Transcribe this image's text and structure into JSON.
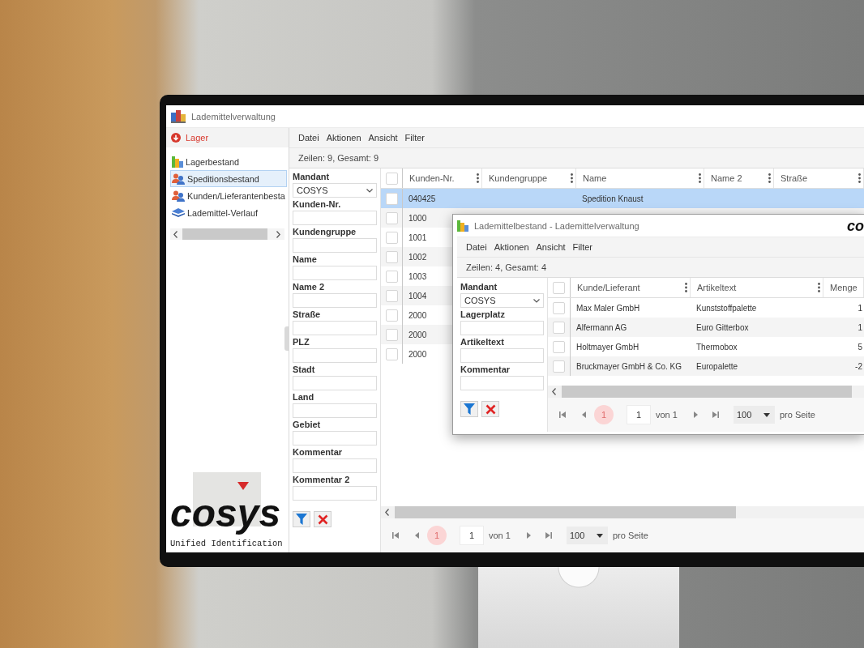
{
  "main_window": {
    "title": "Lademittelverwaltung",
    "sidebar": {
      "group": {
        "label": "Lager",
        "expanded": true
      },
      "items": [
        {
          "kind": "chart",
          "label": "Lagerbestand",
          "selected": false
        },
        {
          "kind": "people",
          "label": "Speditionsbestand",
          "selected": true
        },
        {
          "kind": "people",
          "label": "Kunden/Lieferantenbesta",
          "selected": false
        },
        {
          "kind": "layers",
          "label": "Lademittel-Verlauf",
          "selected": false
        }
      ]
    },
    "logo": {
      "wordmark": "cosys",
      "tagline": "Unified Identification"
    },
    "menu": [
      "Datei",
      "Aktionen",
      "Ansicht",
      "Filter"
    ],
    "status": "Zeilen: 9, Gesamt: 9",
    "filters": [
      {
        "kind": "select",
        "label": "Mandant",
        "value": "COSYS"
      },
      {
        "kind": "text",
        "label": "Kunden-Nr."
      },
      {
        "kind": "text",
        "label": "Kundengruppe"
      },
      {
        "kind": "text",
        "label": "Name"
      },
      {
        "kind": "text",
        "label": "Name 2"
      },
      {
        "kind": "text",
        "label": "Straße"
      },
      {
        "kind": "text",
        "label": "PLZ"
      },
      {
        "kind": "text",
        "label": "Stadt"
      },
      {
        "kind": "text",
        "label": "Land"
      },
      {
        "kind": "text",
        "label": "Gebiet"
      },
      {
        "kind": "text",
        "label": "Kommentar"
      },
      {
        "kind": "text",
        "label": "Kommentar 2"
      }
    ],
    "table": {
      "all_checked": false,
      "columns": [
        {
          "label": "Kunden-Nr.",
          "menu": true
        },
        {
          "label": "Kundengruppe",
          "menu": true
        },
        {
          "label": "Name",
          "menu": true
        },
        {
          "label": "Name 2",
          "menu": true
        },
        {
          "label": "Straße",
          "menu": true
        }
      ],
      "rows": [
        {
          "selected": true,
          "checked": false,
          "cells": [
            "040425",
            null,
            "Spedition Knaust"
          ]
        },
        {
          "selected": false,
          "checked": false,
          "cells": [
            "1000"
          ]
        },
        {
          "selected": false,
          "checked": false,
          "cells": [
            "1001"
          ]
        },
        {
          "selected": false,
          "checked": false,
          "cells": [
            "1002"
          ]
        },
        {
          "selected": false,
          "checked": false,
          "cells": [
            "1003"
          ]
        },
        {
          "selected": false,
          "checked": false,
          "cells": [
            "1004"
          ]
        },
        {
          "selected": false,
          "checked": false,
          "cells": [
            "2000"
          ]
        },
        {
          "selected": false,
          "checked": false,
          "cells": [
            "2000"
          ]
        },
        {
          "selected": false,
          "checked": false,
          "cells": [
            "2000"
          ]
        }
      ]
    },
    "pager": {
      "current": "1",
      "page": "1",
      "of": "von 1",
      "size": "100",
      "per_page": "pro Seite"
    }
  },
  "dialog_window": {
    "title": "Lademittelbestand - Lademittelverwaltung",
    "logo": "co",
    "menu": [
      "Datei",
      "Aktionen",
      "Ansicht",
      "Filter"
    ],
    "status": "Zeilen: 4, Gesamt: 4",
    "filters": [
      {
        "kind": "select",
        "label": "Mandant",
        "value": "COSYS"
      },
      {
        "kind": "text",
        "label": "Lagerplatz"
      },
      {
        "kind": "text",
        "label": "Artikeltext"
      },
      {
        "kind": "text",
        "label": "Kommentar"
      }
    ],
    "table": {
      "all_checked": false,
      "columns": [
        {
          "label": "Kunde/Lieferant",
          "menu": true
        },
        {
          "label": "Artikeltext",
          "menu": true
        },
        {
          "label": "Menge",
          "menu": false
        }
      ],
      "rows": [
        {
          "selected": false,
          "checked": false,
          "cells": [
            "Max Maler GmbH",
            "Kunststoffpalette",
            "1"
          ]
        },
        {
          "selected": false,
          "checked": false,
          "cells": [
            "Alfermann AG",
            "Euro Gitterbox",
            "1"
          ]
        },
        {
          "selected": false,
          "checked": false,
          "cells": [
            "Holtmayer GmbH",
            "Thermobox",
            "5"
          ]
        },
        {
          "selected": false,
          "checked": false,
          "cells": [
            "Bruckmayer GmbH & Co. KG",
            "Europalette",
            "-2"
          ]
        }
      ]
    },
    "pager": {
      "current": "1",
      "page": "1",
      "of": "von 1",
      "size": "100",
      "per_page": "pro Seite"
    }
  }
}
